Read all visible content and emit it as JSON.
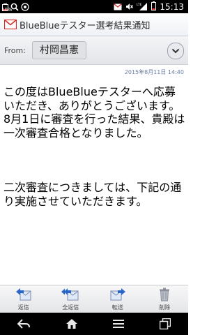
{
  "status_bar": {
    "battery_percent": "10%",
    "time": "15:13"
  },
  "mail": {
    "subject": "BlueBlueテスター選考結果通知",
    "from_label": "From:",
    "from_name": "村岡昌憲",
    "date": "2015年8月11日 14:40",
    "body_paragraph_1": "この度はBlueBlueテスターへ応募いただき、ありがとうございます。",
    "body_paragraph_2": "8月1日に審査を行った結果、貴殿は一次審査合格となりました。",
    "body_paragraph_3": "二次審査につきましては、下記の通り実施させていただきます。"
  },
  "actions": {
    "reply": "返信",
    "reply_all": "全返信",
    "forward": "転送",
    "delete": "削除"
  },
  "icons": {
    "mail": "envelope-icon",
    "back": "back-arrow-icon",
    "home": "home-icon",
    "menu": "menu-icon",
    "recent": "recent-apps-icon"
  },
  "colors": {
    "accent_blue": "#2a66c7",
    "mail_red": "#d62b2b"
  }
}
